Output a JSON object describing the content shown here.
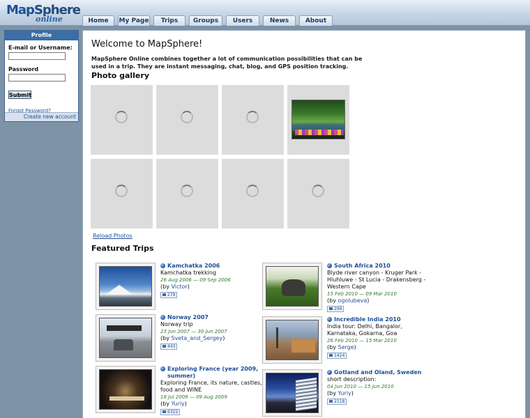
{
  "header": {
    "logo_main_a": "Map",
    "logo_main_b": "Sphere",
    "logo_sub": "online",
    "nav": [
      "Home",
      "My Page",
      "Trips",
      "Groups",
      "Users",
      "News",
      "About"
    ]
  },
  "profile": {
    "title": "Profile",
    "email_label": "E-mail or Username:",
    "email_value": "",
    "password_label": "Password",
    "password_value": "",
    "submit_label": "Submit",
    "forgot_label": "Forgot Password?",
    "create_label": "Create new account"
  },
  "main": {
    "welcome": "Welcome to MapSphere!",
    "intro": "MapSphere Online combines together a lot of communication possibilities that can be used in a trip. They are instant messaging, chat, blog, and GPS position tracking.",
    "gallery_title": "Photo gallery",
    "reload_label": "Reload Photos",
    "featured_title": "Featured Trips"
  },
  "trips": [
    {
      "title": "Kamchatka 2006",
      "desc": "Kamchatka trekking",
      "dates": "26 Aug 2006 — 09 Sep 2006",
      "by_prefix": "(by ",
      "user": "Victor",
      "by_suffix": ")",
      "photos": "279",
      "scene": "kam"
    },
    {
      "title": "Norway 2007",
      "desc": "Norway trip",
      "dates": "23 Jun 2007 — 30 Jun 2007",
      "by_prefix": "(by ",
      "user": "Sveta_and_Sergey",
      "by_suffix": ")",
      "photos": "443",
      "scene": "nor"
    },
    {
      "title": "Exploring France (year 2009, summer)",
      "desc": "Exploring France, its nature, castles, food and WINE",
      "dates": "18 Jul 2009 — 09 Aug 2009",
      "by_prefix": "(by ",
      "user": "Yuriy",
      "by_suffix": ")",
      "photos": "6322",
      "scene": "fra"
    },
    {
      "title": "South Africa 2010",
      "desc": "Blyde river canyon - Kruger Park - Hluhluwe - St Lucia - Drakensberg - Western Cape",
      "dates": "15 Feb 2010 — 09 Mar 2010",
      "by_prefix": "(by ",
      "user": "ogolubeva",
      "by_suffix": ")",
      "photos": "299",
      "scene": "afr"
    },
    {
      "title": "Incredible India 2010",
      "desc": "India tour: Delhi, Bangalor, Karnataka, Gokarna, Goa",
      "dates": "26 Feb 2010 — 15 Mar 2010",
      "by_prefix": "(by ",
      "user": "Serge",
      "by_suffix": ")",
      "photos": "1424",
      "scene": "ind"
    },
    {
      "title": "Gotland and Oland, Sweden",
      "desc": "short description:",
      "dates": "04 Jun 2010 — 15 Jun 2010",
      "by_prefix": "(by ",
      "user": "Yuriy",
      "by_suffix": ")",
      "photos": "2118",
      "scene": "got"
    }
  ]
}
